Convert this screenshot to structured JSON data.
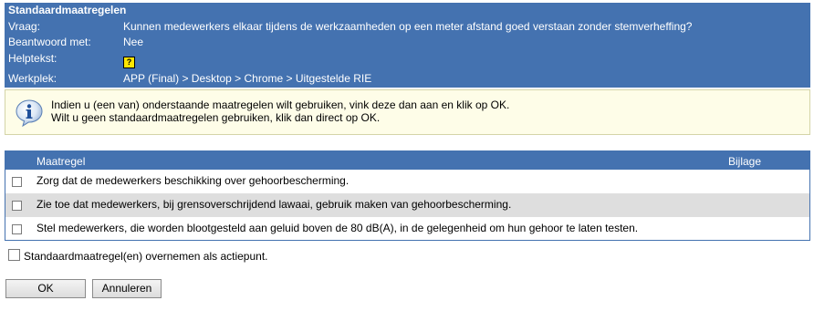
{
  "header": {
    "title": "Standaardmaatregelen",
    "rows": [
      {
        "label": "Vraag:",
        "value": "Kunnen medewerkers elkaar tijdens de werkzaamheden op een meter afstand goed verstaan zonder stemverheffing?"
      },
      {
        "label": "Beantwoord met:",
        "value": "Nee"
      },
      {
        "label": "Helptekst:",
        "icon": "help-icon",
        "icon_glyph": "?"
      },
      {
        "label": "Werkplek:",
        "value": "APP (Final) > Desktop > Chrome > Uitgestelde RIE"
      }
    ]
  },
  "info": {
    "icon": "info-icon",
    "line1": "Indien u (een van) onderstaande maatregelen wilt gebruiken, vink deze dan aan en klik op OK.",
    "line2": "Wilt u geen standaardmaatregelen gebruiken, klik dan direct op OK."
  },
  "table": {
    "headers": {
      "maatregel": "Maatregel",
      "bijlage": "Bijlage"
    },
    "rows": [
      {
        "text": "Zorg dat de medewerkers beschikking over gehoorbescherming.",
        "checked": false
      },
      {
        "text": "Zie toe dat medewerkers, bij grensoverschrijdend lawaai, gebruik maken van gehoorbescherming.",
        "checked": false
      },
      {
        "text": "Stel medewerkers, die worden blootgesteld aan geluid boven de 80 dB(A), in de gelegenheid om hun gehoor te laten testen.",
        "checked": false
      }
    ]
  },
  "overnemen": {
    "label": "Standaardmaatregel(en) overnemen als actiepunt.",
    "checked": false
  },
  "buttons": {
    "ok": "OK",
    "cancel": "Annuleren"
  },
  "colors": {
    "header_bg": "#4472b0",
    "info_bg": "#fefde8",
    "alt_row": "#dedede"
  }
}
